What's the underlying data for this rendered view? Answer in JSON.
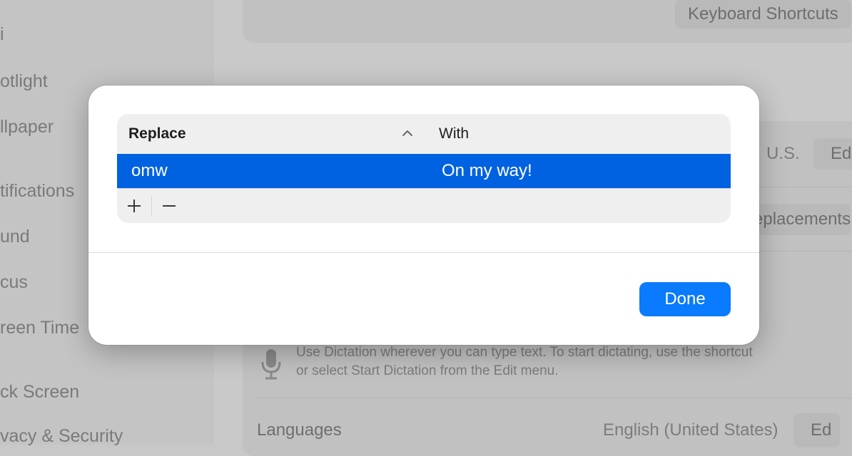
{
  "sidebar": {
    "items": [
      {
        "label": "i"
      },
      {
        "label": "otlight"
      },
      {
        "label": "llpaper"
      },
      {
        "label": "tifications"
      },
      {
        "label": "und"
      },
      {
        "label": "cus"
      },
      {
        "label": "reen Time"
      },
      {
        "label": "ck Screen"
      },
      {
        "label": "vacy & Security"
      }
    ]
  },
  "background": {
    "keyboard_shortcuts_label": "Keyboard Shortcuts",
    "input_source_value": "U.S.",
    "edit_label": "Ed",
    "text_replacements_label": "eplacements",
    "dictation_description_line1": "Use Dictation wherever you can type text. To start dictating, use the shortcut",
    "dictation_description_line2": "or select Start Dictation from the Edit menu.",
    "languages_label": "Languages",
    "languages_value": "English (United States)",
    "languages_edit_label": "Ed"
  },
  "dialog": {
    "table": {
      "columns": [
        {
          "label": "Replace"
        },
        {
          "label": "With"
        }
      ],
      "sort_icon": "chevron-up-icon",
      "rows": [
        {
          "replace": "omw",
          "with": "On my way!",
          "selected": true
        }
      ],
      "add_icon": "plus-icon",
      "remove_icon": "minus-icon"
    },
    "done_label": "Done"
  },
  "colors": {
    "selection": "#0062e0",
    "accent_button": "#0a7aff"
  }
}
